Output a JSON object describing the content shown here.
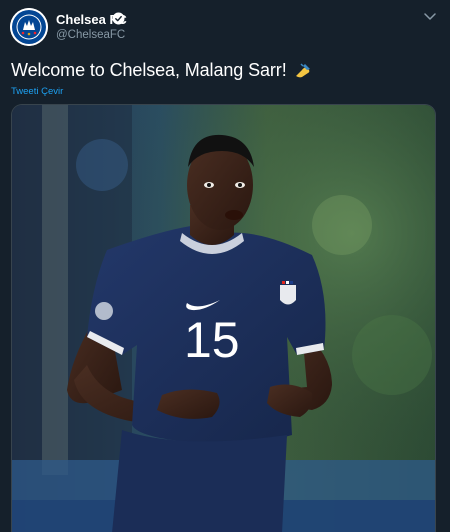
{
  "account": {
    "display_name": "Chelsea FC",
    "handle": "@ChelseaFC",
    "verified": true,
    "avatar_icon": "chelsea-crest-icon",
    "caret_icon": "chevron-down-icon"
  },
  "tweet": {
    "text": "Welcome to Chelsea, Malang Sarr!",
    "emoji_icon": "writing-hand-icon",
    "translate_label": "Tweeti Çevir"
  },
  "media": {
    "jersey_number": "15"
  },
  "colors": {
    "background": "#15202b",
    "link": "#1da1f2",
    "secondary_text": "#8899a6",
    "jersey": "#1c2f5e"
  }
}
